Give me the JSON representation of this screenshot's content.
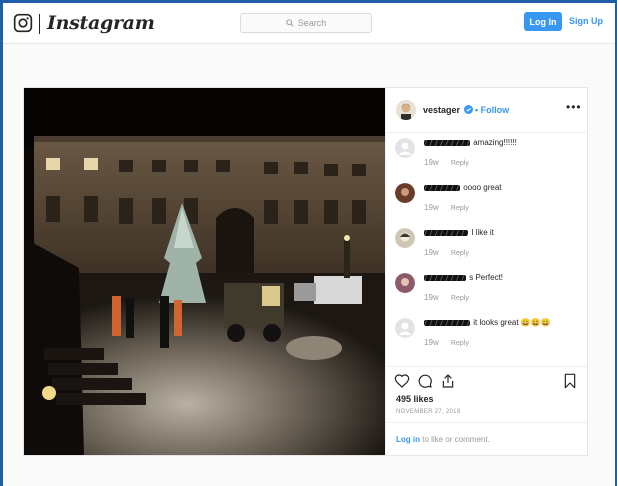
{
  "header": {
    "logo": "Instagram",
    "search_placeholder": "Search",
    "login_label": "Log In",
    "signup_label": "Sign Up"
  },
  "post": {
    "author": "vestager",
    "follow_label": "Follow",
    "separator": "•",
    "more_label": "•••",
    "image_alt": "Night courtyard with Christmas tree being installed by workers and a small loader",
    "comments": [
      {
        "text": "amazing!!!!!!",
        "time": "19w",
        "reply": "Reply",
        "avatar_color": "#e3e3e3"
      },
      {
        "text": "oooo great",
        "time": "19w",
        "reply": "Reply",
        "avatar_color": "#6b3b2a"
      },
      {
        "text": "I like it",
        "time": "19w",
        "reply": "Reply",
        "avatar_color": "#cfc7b5"
      },
      {
        "text": "s Perfect!",
        "time": "19w",
        "reply": "Reply",
        "avatar_color": "#8c5a6a"
      },
      {
        "text": "it looks great 😀😀😀",
        "time": "19w",
        "reply": "Reply",
        "avatar_color": "#e3e3e3"
      }
    ],
    "likes": "495 likes",
    "date": "NOVEMBER 27, 2018",
    "login_link": "Log in",
    "login_suffix": " to like or comment."
  },
  "colors": {
    "accent": "#3897f0",
    "frame": "#1f5fa8"
  },
  "icons": [
    "camera-icon",
    "search-icon",
    "verified-icon",
    "heart-icon",
    "comment-icon",
    "share-icon",
    "bookmark-icon"
  ]
}
